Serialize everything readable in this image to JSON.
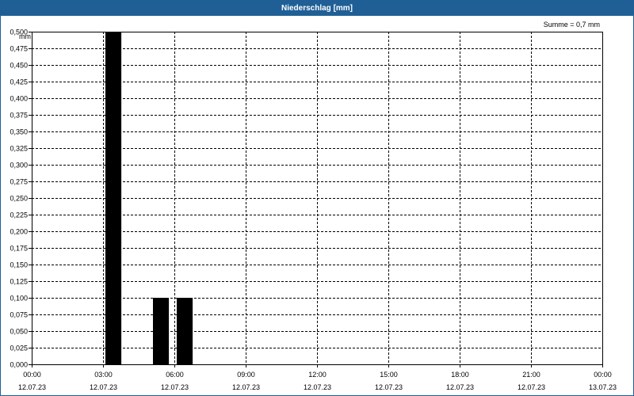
{
  "window": {
    "title": "Niederschlag [mm]"
  },
  "chart_data": {
    "type": "bar",
    "title": "Niederschlag [mm]",
    "ylabel": "mm",
    "annotation": "Summe = 0,7 mm",
    "ylim": [
      0,
      0.5
    ],
    "yticks": [
      "0,000",
      "0,025",
      "0,050",
      "0,075",
      "0,100",
      "0,125",
      "0,150",
      "0,175",
      "0,200",
      "0,225",
      "0,250",
      "0,275",
      "0,300",
      "0,325",
      "0,350",
      "0,375",
      "0,400",
      "0,425",
      "0,450",
      "0,475",
      "0,500"
    ],
    "xlim_hours": [
      0,
      24
    ],
    "xticks": [
      {
        "time": "00:00",
        "date": "12.07.23"
      },
      {
        "time": "03:00",
        "date": "12.07.23"
      },
      {
        "time": "06:00",
        "date": "12.07.23"
      },
      {
        "time": "09:00",
        "date": "12.07.23"
      },
      {
        "time": "12:00",
        "date": "12.07.23"
      },
      {
        "time": "15:00",
        "date": "12.07.23"
      },
      {
        "time": "18:00",
        "date": "12.07.23"
      },
      {
        "time": "21:00",
        "date": "12.07.23"
      },
      {
        "time": "00:00",
        "date": "13.07.23"
      }
    ],
    "bar_width_hours": 0.67,
    "bars": [
      {
        "start_hour": 3.1,
        "value": 0.5
      },
      {
        "start_hour": 5.1,
        "value": 0.1
      },
      {
        "start_hour": 6.1,
        "value": 0.1
      }
    ],
    "bar_color": "#000000",
    "grid": true
  }
}
